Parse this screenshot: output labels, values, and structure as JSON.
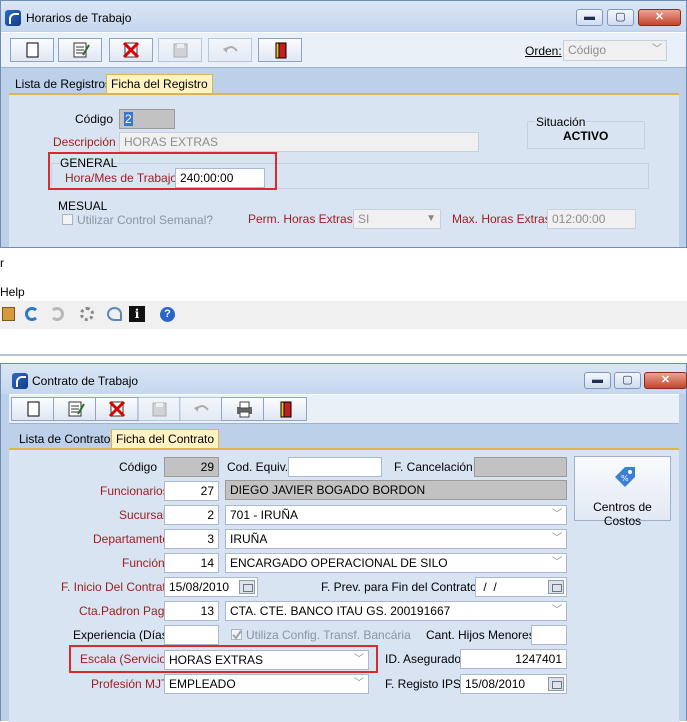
{
  "win1": {
    "title": "Horarios de Trabajo",
    "orden_label": "Orden:",
    "orden_value": "Código",
    "tabs": [
      "Lista de Registros",
      "Ficha del Registro"
    ],
    "codigo_label": "Código",
    "codigo_value": "2",
    "descripcion_label": "Descripción",
    "descripcion_value": "HORAS EXTRAS",
    "situacion_label": "Situación",
    "situacion_value": "ACTIVO",
    "general_label": "GENERAL",
    "hora_mes_label": "Hora/Mes de Trabajo",
    "hora_mes_value": "240:00:00",
    "mesual_label": "MESUAL",
    "utilizar_label": "Utilizar Control Semanal?",
    "perm_label": "Perm. Horas Extras?",
    "perm_value": "SI",
    "max_label": "Max. Horas Extras",
    "max_value": "012:00:00"
  },
  "fragment": {
    "menu_r": "r",
    "help": "Help"
  },
  "win2": {
    "title": "Contrato de Trabajo",
    "tabs": [
      "Lista de Contratos",
      "Ficha del Contrato"
    ],
    "codigo_label": "Código",
    "codigo_value": "29",
    "cod_equiv_label": "Cod. Equiv.",
    "cod_equiv_value": "",
    "f_cancel_label": "F. Cancelación",
    "funcionarios_label": "Funcionarios",
    "funcionarios_num": "27",
    "funcionarios_name": "DIEGO JAVIER BOGADO BORDON",
    "sucursal_label": "Sucursal",
    "sucursal_num": "2",
    "sucursal_name": "701 - IRUÑA",
    "departamento_label": "Departamento",
    "departamento_num": "3",
    "departamento_name": "IRUÑA",
    "funcion_label": "Función",
    "funcion_num": "14",
    "funcion_name": "ENCARGADO OPERACIONAL DE SILO",
    "inicio_label": "F. Inicio Del Contrato",
    "inicio_value": "15/08/2010",
    "prev_fin_label": "F. Prev. para Fin del Contrato",
    "prev_fin_value": " /  /",
    "cta_label": "Cta.Padron Pago",
    "cta_num": "13",
    "cta_name": "CTA. CTE. BANCO ITAU GS. 200191667",
    "experiencia_label": "Experiencia (Días)",
    "experiencia_value": "",
    "utiliza_label": "Utiliza Config. Transf. Bancária",
    "hijos_label": "Cant. Hijos Menores",
    "hijos_value": "",
    "escala_label": "Escala (Servicio)",
    "escala_value": "HORAS EXTRAS",
    "id_asegurado_label": "ID. Asegurado",
    "id_asegurado_value": "1247401",
    "profesion_label": "Profesión MJT",
    "profesion_value": "EMPLEADO",
    "registo_ips_label": "F. Registo IPS",
    "registo_ips_value": "15/08/2010",
    "centros_label": "Centros de Costos"
  },
  "colors": {
    "highlight_box": "#d92b2b",
    "required_label": "#9d1c1c",
    "active_tab": "#fff3c4"
  }
}
